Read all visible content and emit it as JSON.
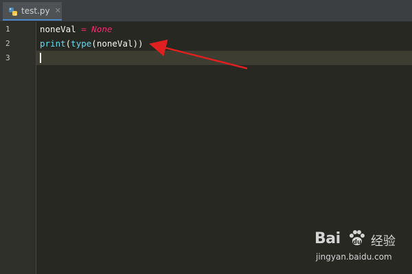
{
  "tab": {
    "filename": "test.py",
    "close_glyph": "✕",
    "icon": "python-file-icon"
  },
  "gutter": {
    "line_numbers": [
      "1",
      "2",
      "3"
    ]
  },
  "code": {
    "line1": {
      "var": "noneVal",
      "eq": " = ",
      "value": "None"
    },
    "line2": {
      "print": "print",
      "p1": "(",
      "type": "type",
      "p2": "(",
      "arg": "noneVal",
      "p3": "))"
    }
  },
  "watermark": {
    "logo": "Bai",
    "logo_suffix": "",
    "brand_cn": "经验",
    "url": "jingyan.baidu.com"
  },
  "colors": {
    "background": "#272822",
    "keyword": "#f92672",
    "function": "#66d9ef",
    "identifier": "#f8f8f2",
    "arrow": "#e02020"
  }
}
